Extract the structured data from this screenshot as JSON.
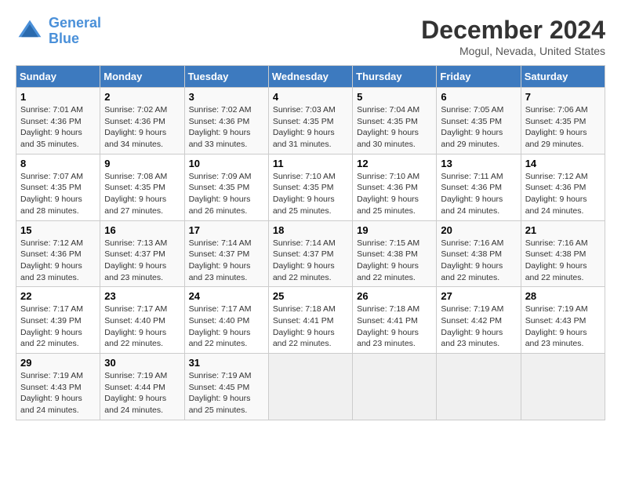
{
  "logo": {
    "line1": "General",
    "line2": "Blue"
  },
  "title": "December 2024",
  "subtitle": "Mogul, Nevada, United States",
  "days_of_week": [
    "Sunday",
    "Monday",
    "Tuesday",
    "Wednesday",
    "Thursday",
    "Friday",
    "Saturday"
  ],
  "weeks": [
    [
      {
        "day": "1",
        "info": "Sunrise: 7:01 AM\nSunset: 4:36 PM\nDaylight: 9 hours\nand 35 minutes."
      },
      {
        "day": "2",
        "info": "Sunrise: 7:02 AM\nSunset: 4:36 PM\nDaylight: 9 hours\nand 34 minutes."
      },
      {
        "day": "3",
        "info": "Sunrise: 7:02 AM\nSunset: 4:36 PM\nDaylight: 9 hours\nand 33 minutes."
      },
      {
        "day": "4",
        "info": "Sunrise: 7:03 AM\nSunset: 4:35 PM\nDaylight: 9 hours\nand 31 minutes."
      },
      {
        "day": "5",
        "info": "Sunrise: 7:04 AM\nSunset: 4:35 PM\nDaylight: 9 hours\nand 30 minutes."
      },
      {
        "day": "6",
        "info": "Sunrise: 7:05 AM\nSunset: 4:35 PM\nDaylight: 9 hours\nand 29 minutes."
      },
      {
        "day": "7",
        "info": "Sunrise: 7:06 AM\nSunset: 4:35 PM\nDaylight: 9 hours\nand 29 minutes."
      }
    ],
    [
      {
        "day": "8",
        "info": "Sunrise: 7:07 AM\nSunset: 4:35 PM\nDaylight: 9 hours\nand 28 minutes."
      },
      {
        "day": "9",
        "info": "Sunrise: 7:08 AM\nSunset: 4:35 PM\nDaylight: 9 hours\nand 27 minutes."
      },
      {
        "day": "10",
        "info": "Sunrise: 7:09 AM\nSunset: 4:35 PM\nDaylight: 9 hours\nand 26 minutes."
      },
      {
        "day": "11",
        "info": "Sunrise: 7:10 AM\nSunset: 4:35 PM\nDaylight: 9 hours\nand 25 minutes."
      },
      {
        "day": "12",
        "info": "Sunrise: 7:10 AM\nSunset: 4:36 PM\nDaylight: 9 hours\nand 25 minutes."
      },
      {
        "day": "13",
        "info": "Sunrise: 7:11 AM\nSunset: 4:36 PM\nDaylight: 9 hours\nand 24 minutes."
      },
      {
        "day": "14",
        "info": "Sunrise: 7:12 AM\nSunset: 4:36 PM\nDaylight: 9 hours\nand 24 minutes."
      }
    ],
    [
      {
        "day": "15",
        "info": "Sunrise: 7:12 AM\nSunset: 4:36 PM\nDaylight: 9 hours\nand 23 minutes."
      },
      {
        "day": "16",
        "info": "Sunrise: 7:13 AM\nSunset: 4:37 PM\nDaylight: 9 hours\nand 23 minutes."
      },
      {
        "day": "17",
        "info": "Sunrise: 7:14 AM\nSunset: 4:37 PM\nDaylight: 9 hours\nand 23 minutes."
      },
      {
        "day": "18",
        "info": "Sunrise: 7:14 AM\nSunset: 4:37 PM\nDaylight: 9 hours\nand 22 minutes."
      },
      {
        "day": "19",
        "info": "Sunrise: 7:15 AM\nSunset: 4:38 PM\nDaylight: 9 hours\nand 22 minutes."
      },
      {
        "day": "20",
        "info": "Sunrise: 7:16 AM\nSunset: 4:38 PM\nDaylight: 9 hours\nand 22 minutes."
      },
      {
        "day": "21",
        "info": "Sunrise: 7:16 AM\nSunset: 4:38 PM\nDaylight: 9 hours\nand 22 minutes."
      }
    ],
    [
      {
        "day": "22",
        "info": "Sunrise: 7:17 AM\nSunset: 4:39 PM\nDaylight: 9 hours\nand 22 minutes."
      },
      {
        "day": "23",
        "info": "Sunrise: 7:17 AM\nSunset: 4:40 PM\nDaylight: 9 hours\nand 22 minutes."
      },
      {
        "day": "24",
        "info": "Sunrise: 7:17 AM\nSunset: 4:40 PM\nDaylight: 9 hours\nand 22 minutes."
      },
      {
        "day": "25",
        "info": "Sunrise: 7:18 AM\nSunset: 4:41 PM\nDaylight: 9 hours\nand 22 minutes."
      },
      {
        "day": "26",
        "info": "Sunrise: 7:18 AM\nSunset: 4:41 PM\nDaylight: 9 hours\nand 23 minutes."
      },
      {
        "day": "27",
        "info": "Sunrise: 7:19 AM\nSunset: 4:42 PM\nDaylight: 9 hours\nand 23 minutes."
      },
      {
        "day": "28",
        "info": "Sunrise: 7:19 AM\nSunset: 4:43 PM\nDaylight: 9 hours\nand 23 minutes."
      }
    ],
    [
      {
        "day": "29",
        "info": "Sunrise: 7:19 AM\nSunset: 4:43 PM\nDaylight: 9 hours\nand 24 minutes."
      },
      {
        "day": "30",
        "info": "Sunrise: 7:19 AM\nSunset: 4:44 PM\nDaylight: 9 hours\nand 24 minutes."
      },
      {
        "day": "31",
        "info": "Sunrise: 7:19 AM\nSunset: 4:45 PM\nDaylight: 9 hours\nand 25 minutes."
      },
      null,
      null,
      null,
      null
    ]
  ]
}
